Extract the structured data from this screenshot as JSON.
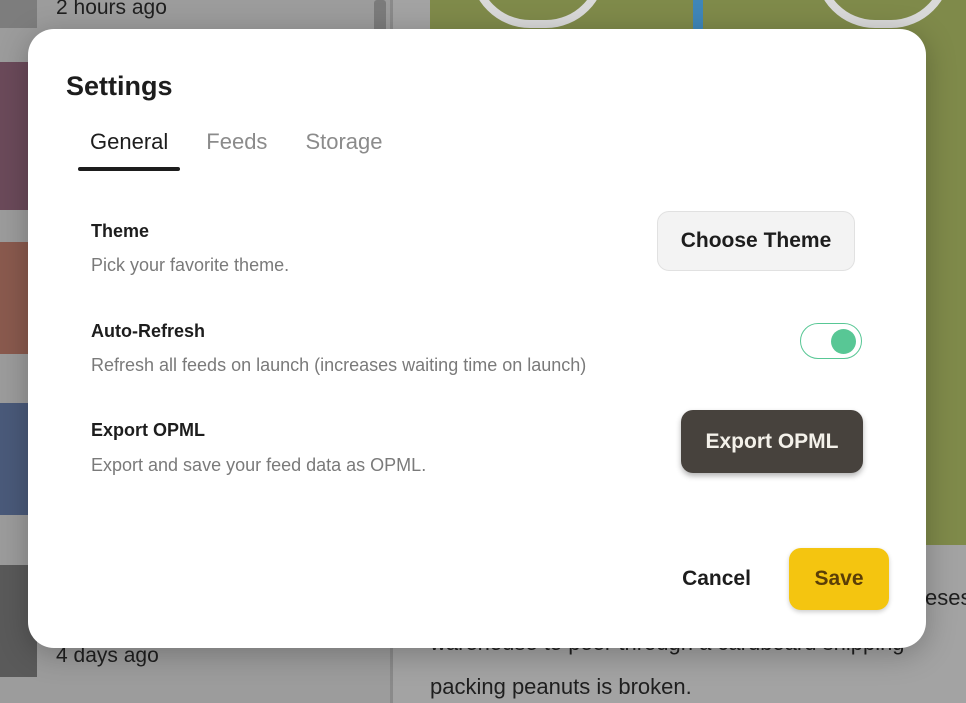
{
  "background": {
    "list_times": [
      "2 hours ago",
      "4 days ago"
    ],
    "article_text_lines": [
      "warehouse to peer through a cardboard shipping",
      "packing peanuts is broken."
    ],
    "article_text_partial": "eses"
  },
  "dialog": {
    "title": "Settings",
    "tabs": [
      {
        "label": "General",
        "active": true
      },
      {
        "label": "Feeds",
        "active": false
      },
      {
        "label": "Storage",
        "active": false
      }
    ],
    "settings": {
      "theme": {
        "label": "Theme",
        "description": "Pick your favorite theme.",
        "button_label": "Choose Theme"
      },
      "auto_refresh": {
        "label": "Auto-Refresh",
        "description": "Refresh all feeds on launch (increases waiting time on launch)",
        "enabled": true
      },
      "export_opml": {
        "label": "Export OPML",
        "description": "Export and save your feed data as OPML.",
        "button_label": "Export OPML"
      }
    },
    "footer": {
      "cancel_label": "Cancel",
      "save_label": "Save"
    }
  },
  "colors": {
    "accent_toggle": "#58c795",
    "save_button": "#f4c510",
    "export_button": "#47423d"
  }
}
